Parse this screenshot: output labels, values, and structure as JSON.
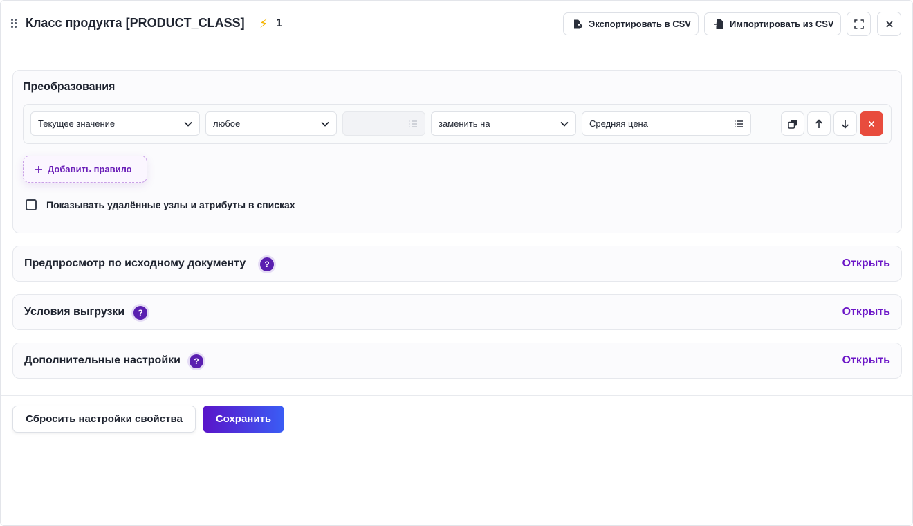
{
  "header": {
    "title": "Класс продукта [PRODUCT_CLASS]",
    "bolt_icon": "bolt-icon",
    "count": "1",
    "export_label": "Экспортировать в CSV",
    "import_label": "Импортировать из CSV"
  },
  "transforms": {
    "title": "Преобразования",
    "rule": {
      "source": "Текущее значение",
      "condition": "любое",
      "condition_value": "",
      "action": "заменить на",
      "target": "Средняя цена"
    },
    "add_rule_label": "Добавить правило",
    "show_deleted_label": "Показывать удалённые узлы и атрибуты в списках",
    "show_deleted_checked": false
  },
  "sections": [
    {
      "title": "Предпросмотр по исходному документу",
      "link": "Открыть"
    },
    {
      "title": "Условия выгрузки",
      "link": "Открыть"
    },
    {
      "title": "Дополнительные настройки",
      "link": "Открыть"
    }
  ],
  "help_symbol": "?",
  "footer": {
    "reset_label": "Сбросить настройки свойства",
    "save_label": "Сохранить"
  },
  "colors": {
    "accent": "#6b16c7",
    "danger": "#e84c3d",
    "save_gradient_start": "#5a14c9",
    "save_gradient_end": "#3a5df5"
  }
}
